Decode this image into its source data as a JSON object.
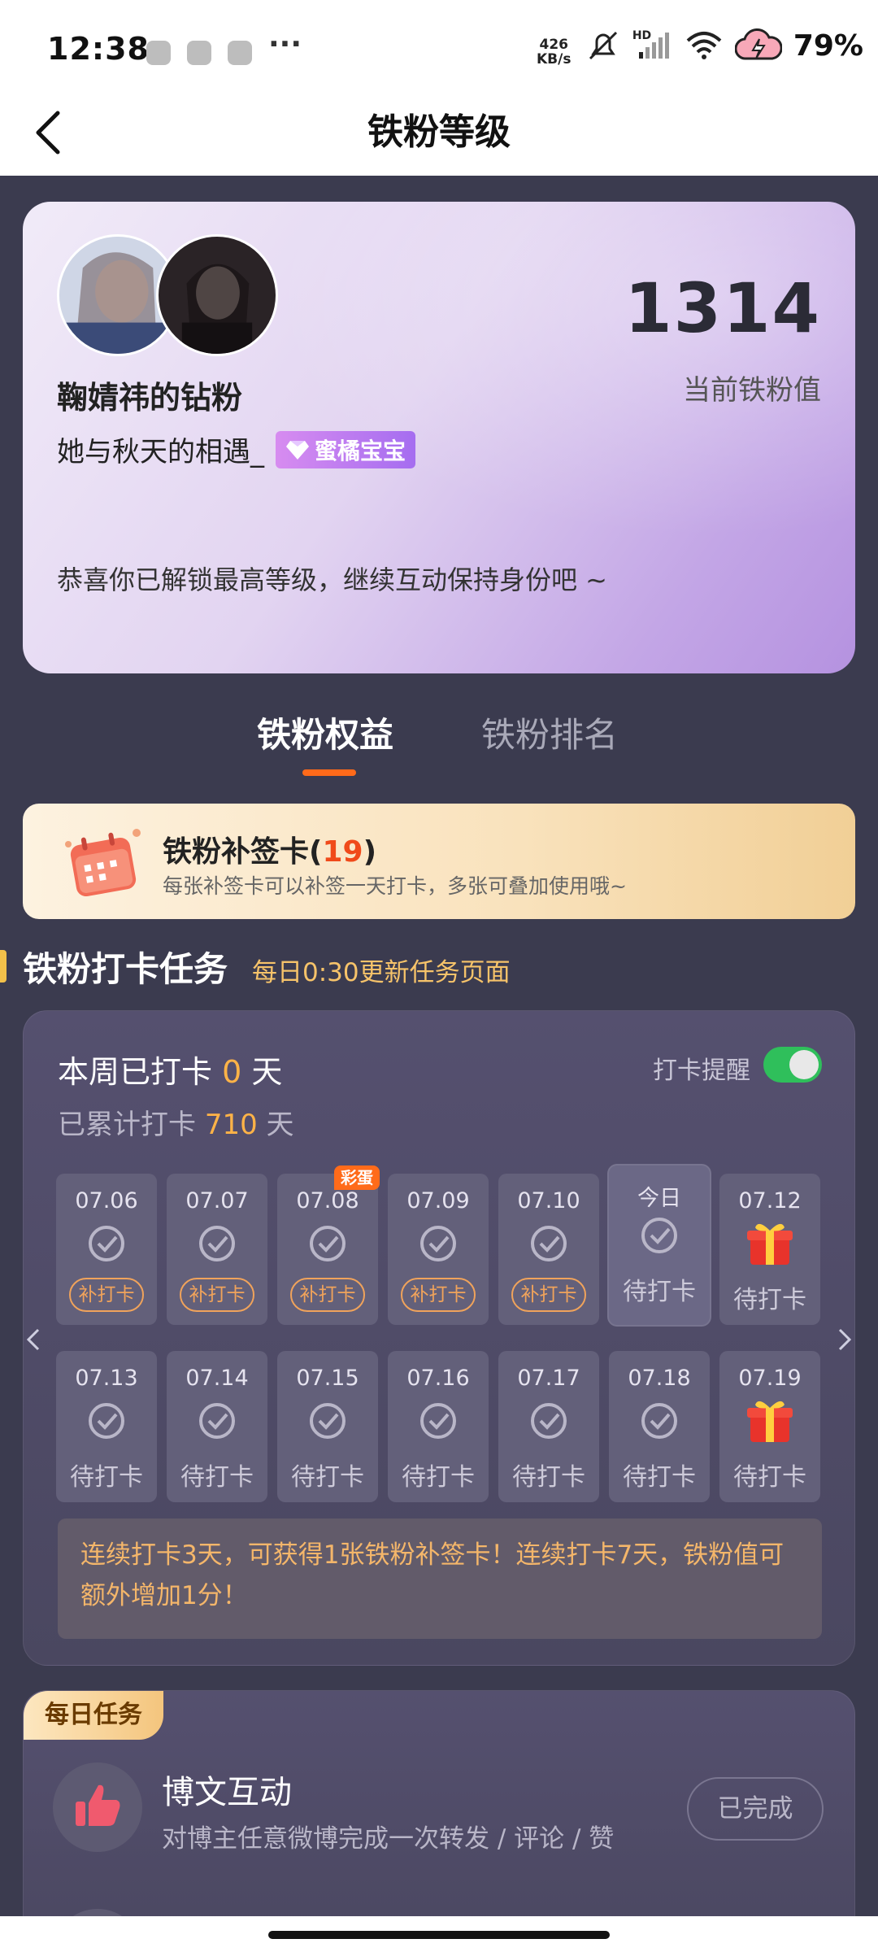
{
  "status_bar": {
    "time": "12:38",
    "net_speed_value": "426",
    "net_speed_unit": "KB/s",
    "network_label": "HD",
    "battery": "79%"
  },
  "header": {
    "title": "铁粉等级"
  },
  "profile": {
    "fan_title": "鞠婧祎的钻粉",
    "username": "她与秋天的相遇_",
    "badge": "蜜橘宝宝",
    "score": "1314",
    "score_label": "当前铁粉值",
    "congrats": "恭喜你已解锁最高等级，继续互动保持身份吧 ~"
  },
  "tabs": [
    {
      "label": "铁粉权益",
      "active": true
    },
    {
      "label": "铁粉排名",
      "active": false
    }
  ],
  "makeup_card": {
    "title_prefix": "铁粉补签卡(",
    "count": "19",
    "title_suffix": ")",
    "desc": "每张补签卡可以补签一天打卡，多张可叠加使用哦~"
  },
  "checkin": {
    "section_title": "铁粉打卡任务",
    "section_note": "每日0:30更新任务页面",
    "week_prefix": "本周已打卡",
    "week_count": "0",
    "day_unit": "天",
    "total_prefix": "已累计打卡",
    "total_count": "710",
    "reminder_label": "打卡提醒",
    "reminder_on": true,
    "row1": [
      {
        "date": "07.06",
        "status": "补打卡"
      },
      {
        "date": "07.07",
        "status": "补打卡"
      },
      {
        "date": "07.08",
        "status": "补打卡",
        "tag": "彩蛋"
      },
      {
        "date": "07.09",
        "status": "补打卡"
      },
      {
        "date": "07.10",
        "status": "补打卡"
      },
      {
        "date": "今日",
        "status": "待打卡"
      },
      {
        "date": "07.12",
        "status": "待打卡"
      }
    ],
    "row2": [
      {
        "date": "07.13",
        "status": "待打卡"
      },
      {
        "date": "07.14",
        "status": "待打卡"
      },
      {
        "date": "07.15",
        "status": "待打卡"
      },
      {
        "date": "07.16",
        "status": "待打卡"
      },
      {
        "date": "07.17",
        "status": "待打卡"
      },
      {
        "date": "07.18",
        "status": "待打卡"
      },
      {
        "date": "07.19",
        "status": "待打卡"
      }
    ],
    "tip": "连续打卡3天，可获得1张铁粉补签卡！连续打卡7天，铁粉值可额外增加1分！"
  },
  "daily_tasks": {
    "tag": "每日任务",
    "items": [
      {
        "title": "博文互动",
        "desc": "对博主任意微博完成一次转发 / 评论 / 赞",
        "button": "已完成"
      }
    ]
  },
  "colors": {
    "accent_orange": "#ff6a1a",
    "toggle_green": "#2fbf5b",
    "panel_bg": "#3b3b4f",
    "tip_text": "#f4b66a"
  }
}
